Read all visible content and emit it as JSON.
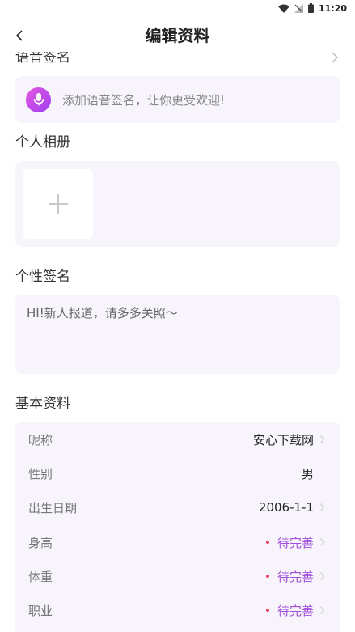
{
  "status_bar": {
    "time": "11:20"
  },
  "header": {
    "title": "编辑资料"
  },
  "voice": {
    "title": "语音签名",
    "hint": "添加语音签名，让你更受欢迎!"
  },
  "album": {
    "title": "个人相册"
  },
  "signature": {
    "title": "个性签名",
    "text": "HI!新人报道，请多多关照～"
  },
  "basic_info": {
    "title": "基本资料",
    "rows": [
      {
        "label": "昵称",
        "value": "安心下载网"
      },
      {
        "label": "性别",
        "value": "男"
      },
      {
        "label": "出生日期",
        "value": "2006-1-1"
      },
      {
        "label": "身高",
        "value": "待完善"
      },
      {
        "label": "体重",
        "value": "待完善"
      },
      {
        "label": "职业",
        "value": "待完善"
      }
    ]
  },
  "colors": {
    "accent": "#a24fd8",
    "pending_dot": "#ee4466",
    "card_bg": "#f7f5fb"
  }
}
